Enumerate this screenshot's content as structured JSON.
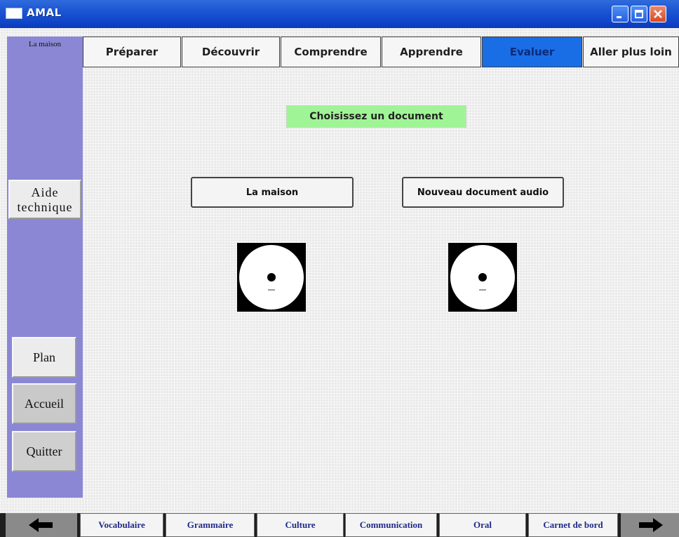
{
  "window": {
    "title": "AMAL"
  },
  "sidebar": {
    "title": "La maison",
    "help_button": "Aide technique",
    "plan_button": "Plan",
    "home_button": "Accueil",
    "quit_button": "Quitter"
  },
  "tabs": [
    "Préparer",
    "Découvrir",
    "Comprendre",
    "Apprendre",
    "Evaluer",
    "Aller plus loin"
  ],
  "active_tab": "Evaluer",
  "main": {
    "prompt": "Choisissez un document",
    "documents": [
      {
        "label": "La maison",
        "icon": "cd-icon"
      },
      {
        "label": "Nouveau document audio",
        "icon": "cd-icon"
      }
    ]
  },
  "bottom_tabs": [
    "Vocabulaire",
    "Grammaire",
    "Culture",
    "Communication",
    "Oral",
    "Carnet de bord"
  ],
  "colors": {
    "sidebar": "#8b87d5",
    "active_tab": "#1a6ee5",
    "prompt_bg": "#9ff595",
    "titlebar": "#0f45c9"
  }
}
